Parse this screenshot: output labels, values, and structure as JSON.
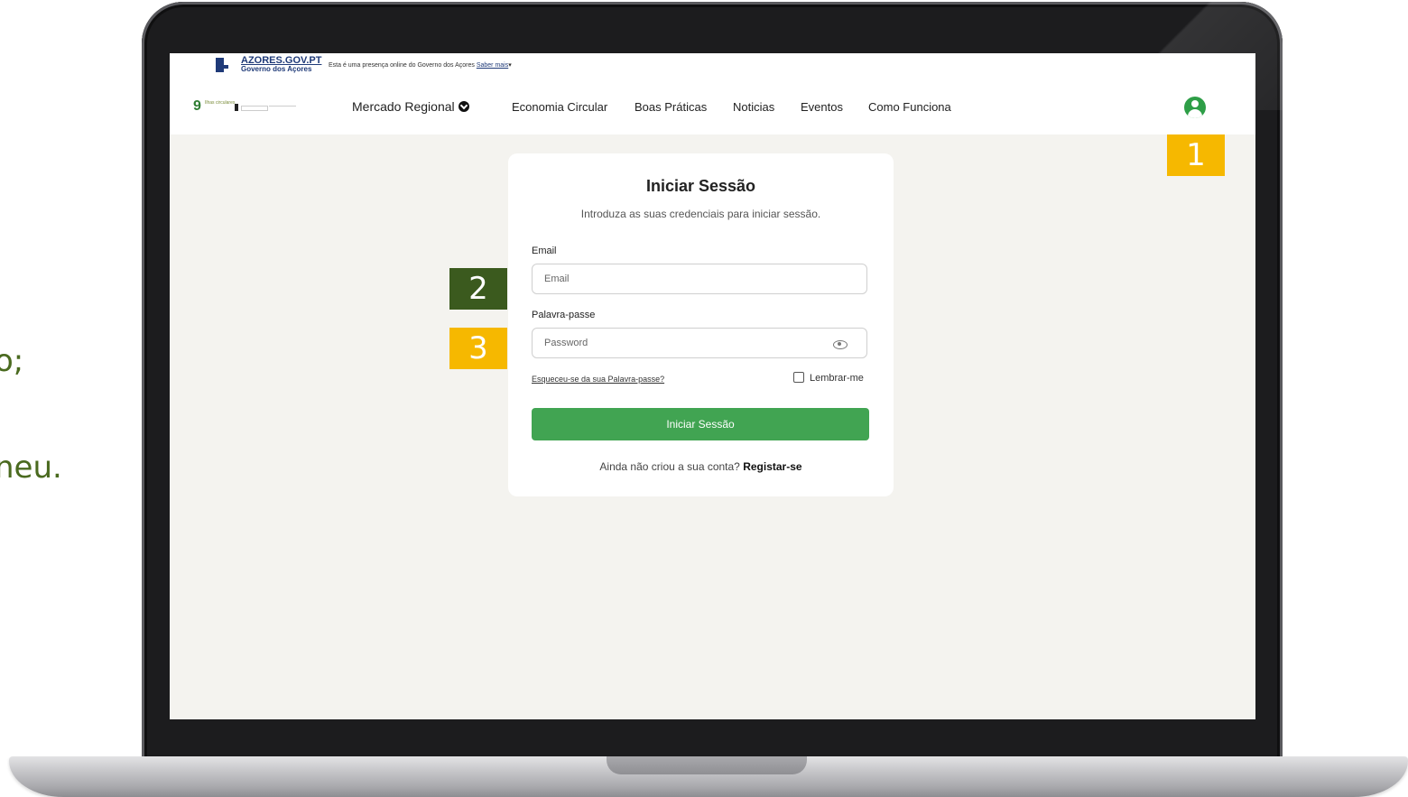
{
  "slide": {
    "left_fragment_1": "o;",
    "left_fragment_2": "neu."
  },
  "gov_bar": {
    "site_name": "AZORES.GOV.PT",
    "org_name": "Governo dos Açores",
    "info_text": "Esta é uma presença online do Governo dos Açores",
    "info_link": "Saber mais"
  },
  "nav": {
    "brand_number": "9",
    "brand_sub": "Ilhas circulares",
    "items": [
      {
        "label": "Mercado Regional"
      },
      {
        "label": "Economia Circular"
      },
      {
        "label": "Boas Práticas"
      },
      {
        "label": "Noticias"
      },
      {
        "label": "Eventos"
      },
      {
        "label": "Como Funciona"
      }
    ],
    "user_icon": "user-circle-icon"
  },
  "login": {
    "title": "Iniciar Sessão",
    "subtitle": "Introduza as suas credenciais para iniciar sessão.",
    "email_label": "Email",
    "email_placeholder": "Email",
    "password_label": "Palavra-passe",
    "password_placeholder": "Password",
    "forgot": "Esqueceu-se da sua Palavra-passe?",
    "remember": "Lembrar-me",
    "submit": "Iniciar Sessão",
    "register_prompt": "Ainda não criou a sua conta?",
    "register_link": "Registar-se"
  },
  "annotations": {
    "badge_1": "1",
    "badge_2": "2",
    "badge_3": "3"
  },
  "colors": {
    "accent_green": "#41a452",
    "badge_yellow": "#f6b800",
    "badge_green": "#3b5a1e",
    "gov_blue": "#1f3a78"
  }
}
